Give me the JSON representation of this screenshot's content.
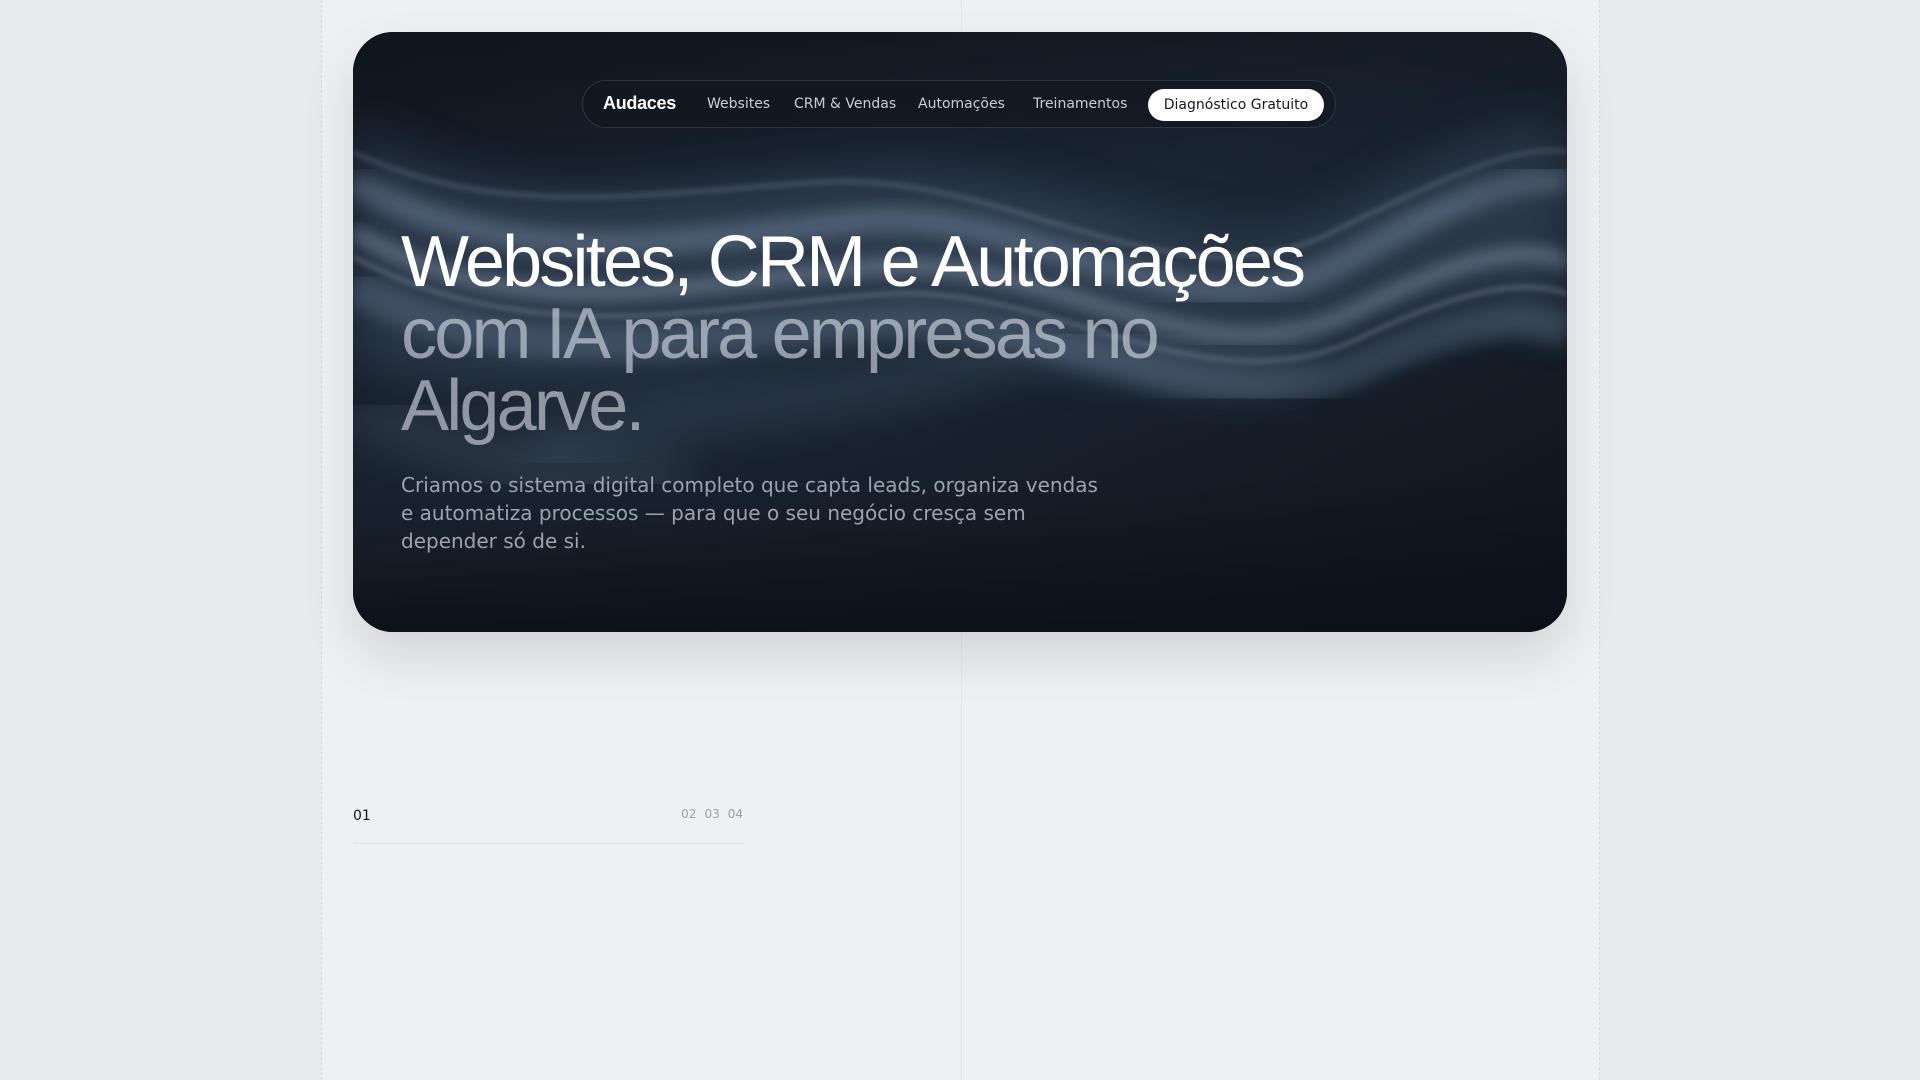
{
  "nav": {
    "brand": "Audaces",
    "links": [
      "Websites",
      "CRM & Vendas",
      "Automações",
      "Treinamentos"
    ],
    "cta_label": "Diagnóstico Gratuito"
  },
  "hero": {
    "headline_line1": "Websites, CRM e Automações",
    "headline_line2": "com IA para empresas no Algarve.",
    "subtitle": "Criamos o sistema digital completo que capta leads, organiza vendas e automatiza processos — para que o seu negócio cresça sem depender só de si."
  },
  "pager": {
    "current": "01",
    "others": [
      "02",
      "03",
      "04"
    ]
  },
  "colors": {
    "page_background": "#eff0f4",
    "hero_background": "#141c26",
    "cta_background": "#ffffff",
    "headline_primary": "#ffffff"
  }
}
